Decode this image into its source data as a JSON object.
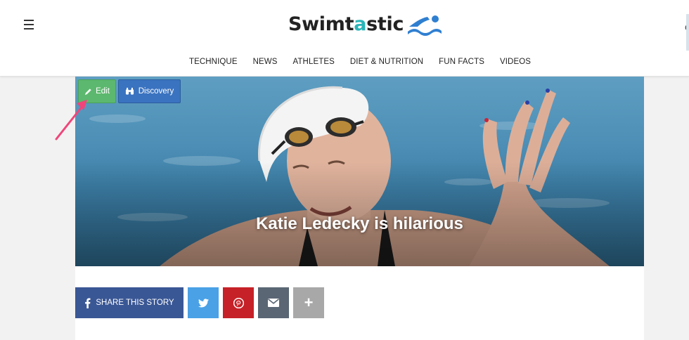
{
  "header": {
    "logo": {
      "text_part1": "Swimt",
      "text_accent": "a",
      "text_part2": "stic",
      "icon": "swimmer-icon",
      "accent_color": "#2bb5b8"
    },
    "menu_icon": "hamburger-icon",
    "right_edge_glyph": "c"
  },
  "nav": {
    "items": [
      {
        "label": "TECHNIQUE"
      },
      {
        "label": "NEWS"
      },
      {
        "label": "ATHLETES"
      },
      {
        "label": "DIET & NUTRITION"
      },
      {
        "label": "FUN FACTS"
      },
      {
        "label": "VIDEOS"
      }
    ]
  },
  "admin": {
    "edit_label": "Edit",
    "edit_icon": "pencil-icon",
    "edit_color": "#5cb86e",
    "discovery_label": "Discovery",
    "discovery_icon": "binoculars-icon",
    "discovery_color": "#3a73c0"
  },
  "hero": {
    "title": "Katie Ledecky is hilarious"
  },
  "share": {
    "story_label": "SHARE THIS STORY",
    "buttons": [
      {
        "name": "facebook",
        "icon": "facebook-icon",
        "color": "#3a5795"
      },
      {
        "name": "twitter",
        "icon": "twitter-icon",
        "color": "#4aa1e6"
      },
      {
        "name": "pinterest",
        "icon": "pinterest-icon",
        "color": "#c62128"
      },
      {
        "name": "email",
        "icon": "envelope-icon",
        "color": "#5a6674"
      },
      {
        "name": "more",
        "icon": "plus-icon",
        "color": "#a8a8a8"
      }
    ],
    "more_label": "+"
  },
  "annotation": {
    "arrow_color": "#f0457a"
  }
}
